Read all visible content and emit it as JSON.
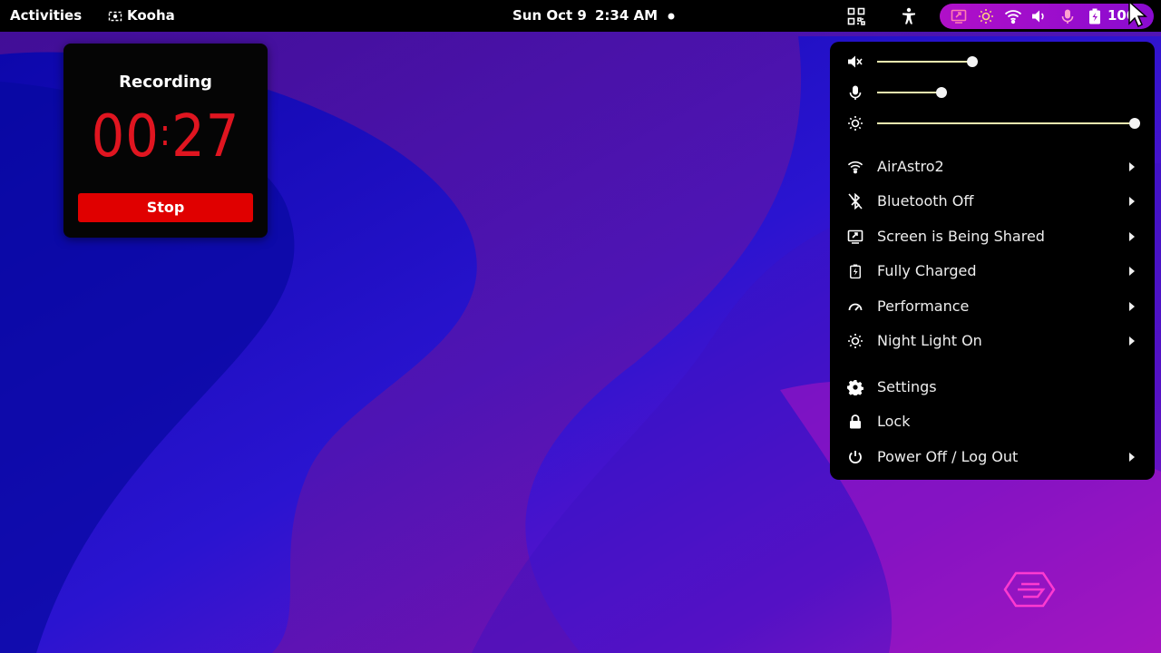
{
  "topbar": {
    "activities": "Activities",
    "app_name": "Kooha",
    "date": "Sun Oct 9",
    "time": "2:34 AM",
    "battery_percent": "100"
  },
  "recording": {
    "title": "Recording",
    "minutes": "00",
    "seconds": "27",
    "stop_label": "Stop"
  },
  "quick_settings": {
    "sliders": {
      "volume": 0.37,
      "microphone": 0.25,
      "brightness": 1.0
    },
    "items": [
      {
        "label": "AirAstro2",
        "icon": "wifi-icon",
        "has_arrow": true
      },
      {
        "label": "Bluetooth Off",
        "icon": "bluetooth-off-icon",
        "has_arrow": true
      },
      {
        "label": "Screen is Being Shared",
        "icon": "screen-share-icon",
        "has_arrow": true
      },
      {
        "label": "Fully Charged",
        "icon": "battery-charged-icon",
        "has_arrow": true
      },
      {
        "label": "Performance",
        "icon": "performance-icon",
        "has_arrow": true
      },
      {
        "label": "Night Light On",
        "icon": "night-light-icon",
        "has_arrow": true
      },
      {
        "label": "Settings",
        "icon": "gear-icon",
        "has_arrow": false
      },
      {
        "label": "Lock",
        "icon": "lock-icon",
        "has_arrow": false
      },
      {
        "label": "Power Off / Log Out",
        "icon": "power-icon",
        "has_arrow": true
      }
    ]
  },
  "colors": {
    "accent_slider": "#f0efb0",
    "recording_red": "#e01520",
    "tray_highlight": "#b010c8"
  }
}
